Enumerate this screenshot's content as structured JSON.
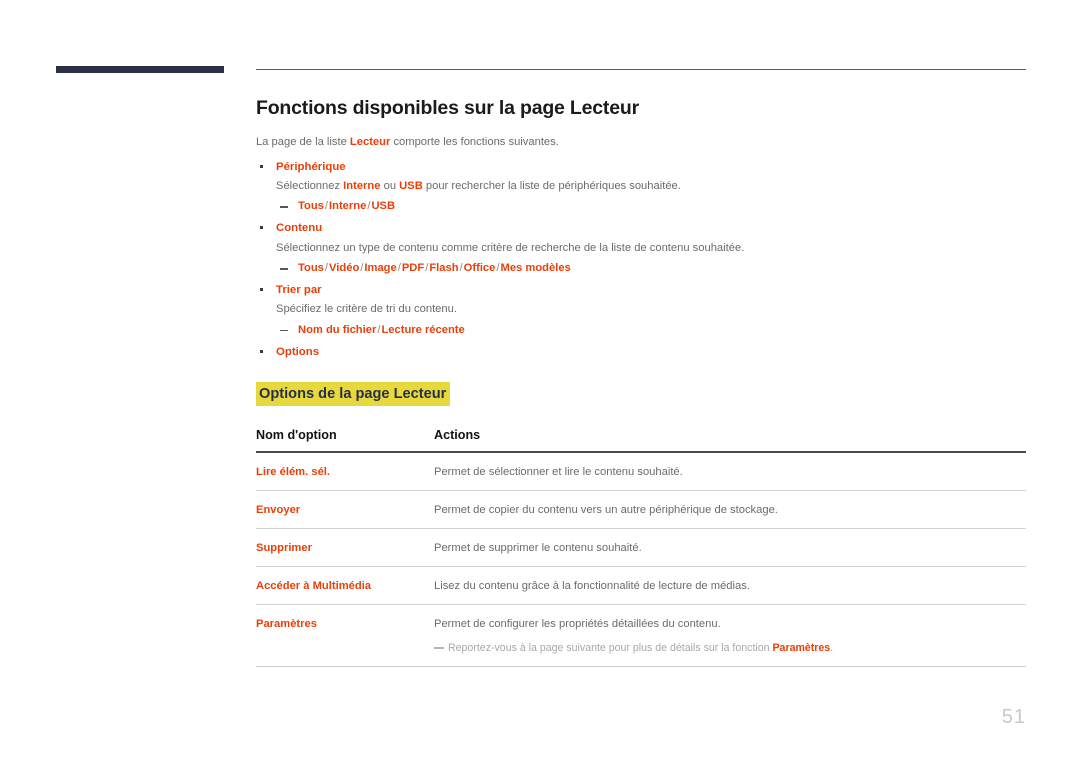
{
  "document": {
    "title": "Fonctions disponibles sur la page Lecteur",
    "intro_before": "La page de la liste ",
    "intro_bold": "Lecteur",
    "intro_after": " comporte les fonctions suivantes.",
    "page_number": "51"
  },
  "colors": {
    "accent_orange": "#e8400a",
    "navy_bar": "#2b3048",
    "highlight_yellow": "#e7d93d",
    "heading_navy": "#26304a",
    "body_gray": "#6b6b6d",
    "note_gray": "#a8a8aa",
    "page_number_gray": "#c9c9cb"
  },
  "bullets": [
    {
      "title": "Périphérique",
      "desc_parts": [
        {
          "text": "Sélectionnez ",
          "bold": false
        },
        {
          "text": "Interne",
          "bold": true
        },
        {
          "text": " ou ",
          "bold": false
        },
        {
          "text": "USB",
          "bold": true
        },
        {
          "text": " pour rechercher la liste de périphériques souhaitée.",
          "bold": false
        }
      ],
      "options": [
        "Tous",
        "Interne",
        "USB"
      ]
    },
    {
      "title": "Contenu",
      "desc_parts": [
        {
          "text": "Sélectionnez un type de contenu comme critère de recherche de la liste de contenu souhaitée.",
          "bold": false
        }
      ],
      "options": [
        "Tous",
        "Vidéo",
        "Image",
        "PDF",
        "Flash",
        "Office",
        "Mes modèles"
      ]
    },
    {
      "title": "Trier par",
      "desc_parts": [
        {
          "text": "Spécifiez le critère de tri du contenu.",
          "bold": false
        }
      ],
      "options": [
        "Nom du fichier",
        "Lecture récente"
      ]
    },
    {
      "title": "Options",
      "desc_parts": [],
      "options": []
    }
  ],
  "section": {
    "heading": "Options de la page Lecteur"
  },
  "table": {
    "headers": [
      "Nom d'option",
      "Actions"
    ],
    "rows": [
      {
        "name": "Lire élém. sél.",
        "action": "Permet de sélectionner et lire le contenu souhaité.",
        "note": null
      },
      {
        "name": "Envoyer",
        "action": "Permet de copier du contenu vers un autre périphérique de stockage.",
        "note": null
      },
      {
        "name": "Supprimer",
        "action": "Permet de supprimer le contenu souhaité.",
        "note": null
      },
      {
        "name": "Accéder à Multimédia",
        "action": "Lisez du contenu grâce à la fonctionnalité de lecture de médias.",
        "note": null
      },
      {
        "name": "Paramètres",
        "action": "Permet de configurer les propriétés détaillées du contenu.",
        "note": {
          "before": "Reportez-vous à la page suivante pour plus de détails sur la fonction ",
          "bold": "Paramètres",
          "after": "."
        }
      }
    ]
  }
}
